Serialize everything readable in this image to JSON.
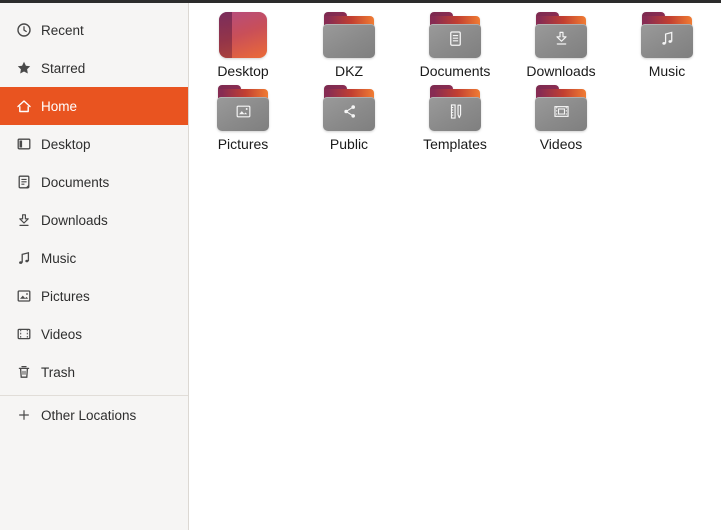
{
  "window": {
    "top_edge_color": "#2c2c2c",
    "accent_color": "#e95420"
  },
  "sidebar": {
    "colors": {
      "background": "#f6f5f4",
      "active_background": "#e95420",
      "active_text": "#ffffff",
      "text": "#2e2e2e"
    },
    "items": [
      {
        "label": "Recent",
        "icon": "clock-icon",
        "active": false
      },
      {
        "label": "Starred",
        "icon": "star-icon",
        "active": false
      },
      {
        "label": "Home",
        "icon": "home-icon",
        "active": true
      },
      {
        "label": "Desktop",
        "icon": "desktop-icon",
        "active": false
      },
      {
        "label": "Documents",
        "icon": "document-icon",
        "active": false
      },
      {
        "label": "Downloads",
        "icon": "download-icon",
        "active": false
      },
      {
        "label": "Music",
        "icon": "music-icon",
        "active": false
      },
      {
        "label": "Pictures",
        "icon": "picture-icon",
        "active": false
      },
      {
        "label": "Videos",
        "icon": "video-icon",
        "active": false
      },
      {
        "label": "Trash",
        "icon": "trash-icon",
        "active": false
      }
    ],
    "footer_item": {
      "label": "Other Locations",
      "icon": "plus-icon"
    }
  },
  "files": {
    "colors": {
      "folder_body": "#8a8a8a",
      "flap_dark": "#7c2a4f",
      "flap_orange": "#f07c33",
      "label_text": "#1a1a1a"
    },
    "items": [
      {
        "name": "Desktop",
        "type": "gradient-desktop",
        "glyph": "none"
      },
      {
        "name": "DKZ",
        "type": "folder",
        "glyph": "none"
      },
      {
        "name": "Documents",
        "type": "folder",
        "glyph": "document-icon"
      },
      {
        "name": "Downloads",
        "type": "folder",
        "glyph": "download-icon"
      },
      {
        "name": "Music",
        "type": "folder",
        "glyph": "music-icon"
      },
      {
        "name": "Pictures",
        "type": "folder",
        "glyph": "picture-icon"
      },
      {
        "name": "Public",
        "type": "folder",
        "glyph": "share-icon"
      },
      {
        "name": "Templates",
        "type": "folder",
        "glyph": "template-icon"
      },
      {
        "name": "Videos",
        "type": "folder",
        "glyph": "video-icon"
      }
    ]
  }
}
